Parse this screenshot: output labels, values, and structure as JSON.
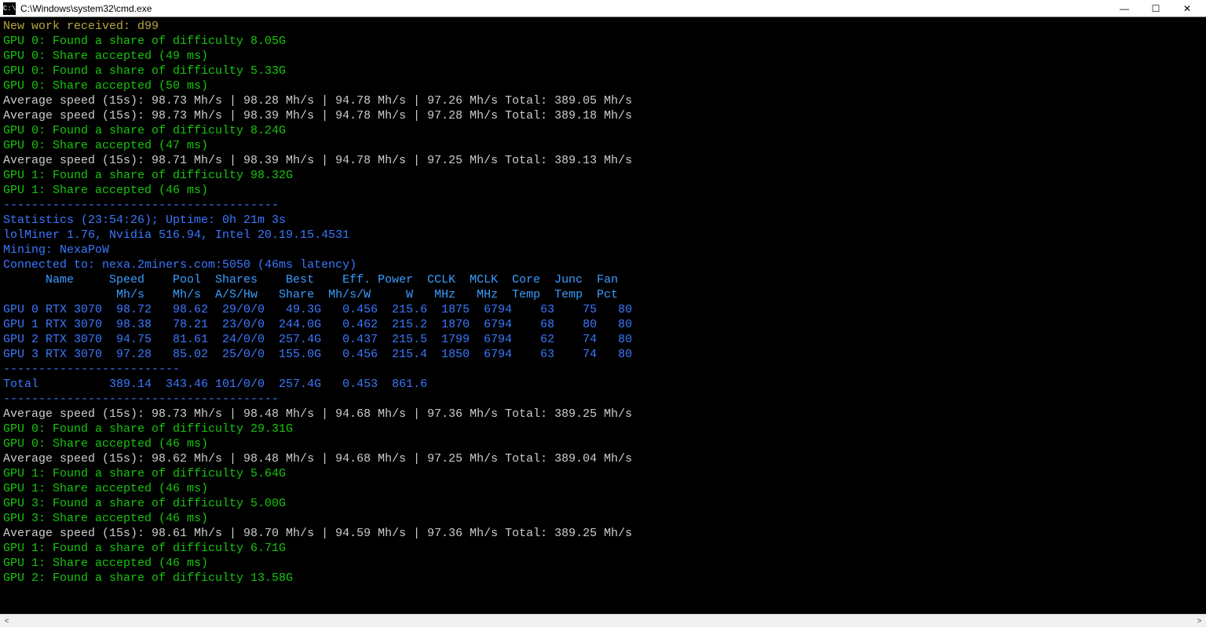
{
  "window": {
    "icon_label": "C:\\",
    "title": "C:\\Windows\\system32\\cmd.exe"
  },
  "lines": [
    {
      "cls": "c-olive",
      "text": "New work received: d99"
    },
    {
      "cls": "c-green",
      "text": "GPU 0: Found a share of difficulty 8.05G"
    },
    {
      "cls": "c-green",
      "text": "GPU 0: Share accepted (49 ms)"
    },
    {
      "cls": "c-green",
      "text": "GPU 0: Found a share of difficulty 5.33G"
    },
    {
      "cls": "c-green",
      "text": "GPU 0: Share accepted (50 ms)"
    },
    {
      "cls": "c-gray",
      "text": "Average speed (15s): 98.73 Mh/s | 98.28 Mh/s | 94.78 Mh/s | 97.26 Mh/s Total: 389.05 Mh/s"
    },
    {
      "cls": "c-gray",
      "text": "Average speed (15s): 98.73 Mh/s | 98.39 Mh/s | 94.78 Mh/s | 97.28 Mh/s Total: 389.18 Mh/s"
    },
    {
      "cls": "c-green",
      "text": "GPU 0: Found a share of difficulty 8.24G"
    },
    {
      "cls": "c-green",
      "text": "GPU 0: Share accepted (47 ms)"
    },
    {
      "cls": "c-gray",
      "text": "Average speed (15s): 98.71 Mh/s | 98.39 Mh/s | 94.78 Mh/s | 97.25 Mh/s Total: 389.13 Mh/s"
    },
    {
      "cls": "c-green",
      "text": "GPU 1: Found a share of difficulty 98.32G"
    },
    {
      "cls": "c-green",
      "text": "GPU 1: Share accepted (46 ms)"
    },
    {
      "cls": "c-blue",
      "text": "---------------------------------------"
    },
    {
      "cls": "c-blue",
      "text": "Statistics (23:54:26); Uptime: 0h 21m 3s"
    },
    {
      "cls": "c-blue",
      "text": "lolMiner 1.76, Nvidia 516.94, Intel 20.19.15.4531"
    },
    {
      "cls": "c-blue",
      "text": "Mining: NexaPoW"
    },
    {
      "cls": "c-blue",
      "text": "Connected to: nexa.2miners.com:5050 (46ms latency)"
    },
    {
      "cls": "c-blue",
      "text": ""
    },
    {
      "cls": "c-bblue",
      "text": "      Name     Speed    Pool  Shares    Best    Eff. Power  CCLK  MCLK  Core  Junc  Fan"
    },
    {
      "cls": "c-bblue",
      "text": "                Mh/s    Mh/s  A/S/Hw   Share  Mh/s/W     W   MHz   MHz  Temp  Temp  Pct"
    },
    {
      "cls": "c-blue",
      "text": "GPU 0 RTX 3070  98.72   98.62  29/0/0   49.3G   0.456  215.6  1875  6794    63    75   80"
    },
    {
      "cls": "c-blue",
      "text": "GPU 1 RTX 3070  98.38   78.21  23/0/0  244.0G   0.462  215.2  1870  6794    68    80   80"
    },
    {
      "cls": "c-blue",
      "text": "GPU 2 RTX 3070  94.75   81.61  24/0/0  257.4G   0.437  215.5  1799  6794    62    74   80"
    },
    {
      "cls": "c-blue",
      "text": "GPU 3 RTX 3070  97.28   85.02  25/0/0  155.0G   0.456  215.4  1850  6794    63    74   80"
    },
    {
      "cls": "c-blue",
      "text": "-------------------------"
    },
    {
      "cls": "c-blue",
      "text": "Total          389.14  343.46 101/0/0  257.4G   0.453  861.6"
    },
    {
      "cls": "c-blue",
      "text": "---------------------------------------"
    },
    {
      "cls": "c-gray",
      "text": "Average speed (15s): 98.73 Mh/s | 98.48 Mh/s | 94.68 Mh/s | 97.36 Mh/s Total: 389.25 Mh/s"
    },
    {
      "cls": "c-green",
      "text": "GPU 0: Found a share of difficulty 29.31G"
    },
    {
      "cls": "c-green",
      "text": "GPU 0: Share accepted (46 ms)"
    },
    {
      "cls": "c-gray",
      "text": "Average speed (15s): 98.62 Mh/s | 98.48 Mh/s | 94.68 Mh/s | 97.25 Mh/s Total: 389.04 Mh/s"
    },
    {
      "cls": "c-green",
      "text": "GPU 1: Found a share of difficulty 5.64G"
    },
    {
      "cls": "c-green",
      "text": "GPU 1: Share accepted (46 ms)"
    },
    {
      "cls": "c-green",
      "text": "GPU 3: Found a share of difficulty 5.00G"
    },
    {
      "cls": "c-green",
      "text": "GPU 3: Share accepted (46 ms)"
    },
    {
      "cls": "c-gray",
      "text": "Average speed (15s): 98.61 Mh/s | 98.70 Mh/s | 94.59 Mh/s | 97.36 Mh/s Total: 389.25 Mh/s"
    },
    {
      "cls": "c-green",
      "text": "GPU 1: Found a share of difficulty 6.71G"
    },
    {
      "cls": "c-green",
      "text": "GPU 1: Share accepted (46 ms)"
    },
    {
      "cls": "c-green",
      "text": "GPU 2: Found a share of difficulty 13.58G"
    }
  ],
  "stats_table": {
    "headers_row1": [
      "",
      "Name",
      "Speed",
      "Pool",
      "Shares",
      "Best",
      "Eff.",
      "Power",
      "CCLK",
      "MCLK",
      "Core",
      "Junc",
      "Fan"
    ],
    "headers_row2": [
      "",
      "",
      "Mh/s",
      "Mh/s",
      "A/S/Hw",
      "Share",
      "Mh/s/W",
      "W",
      "MHz",
      "MHz",
      "Temp",
      "Temp",
      "Pct"
    ],
    "rows": [
      {
        "gpu": "GPU 0",
        "name": "RTX 3070",
        "speed": "98.72",
        "pool": "98.62",
        "shares": "29/0/0",
        "best": "49.3G",
        "eff": "0.456",
        "power": "215.6",
        "cclk": "1875",
        "mclk": "6794",
        "core": "63",
        "junc": "75",
        "fan": "80"
      },
      {
        "gpu": "GPU 1",
        "name": "RTX 3070",
        "speed": "98.38",
        "pool": "78.21",
        "shares": "23/0/0",
        "best": "244.0G",
        "eff": "0.462",
        "power": "215.2",
        "cclk": "1870",
        "mclk": "6794",
        "core": "68",
        "junc": "80",
        "fan": "80"
      },
      {
        "gpu": "GPU 2",
        "name": "RTX 3070",
        "speed": "94.75",
        "pool": "81.61",
        "shares": "24/0/0",
        "best": "257.4G",
        "eff": "0.437",
        "power": "215.5",
        "cclk": "1799",
        "mclk": "6794",
        "core": "62",
        "junc": "74",
        "fan": "80"
      },
      {
        "gpu": "GPU 3",
        "name": "RTX 3070",
        "speed": "97.28",
        "pool": "85.02",
        "shares": "25/0/0",
        "best": "155.0G",
        "eff": "0.456",
        "power": "215.4",
        "cclk": "1850",
        "mclk": "6794",
        "core": "63",
        "junc": "74",
        "fan": "80"
      }
    ],
    "total": {
      "label": "Total",
      "speed": "389.14",
      "pool": "343.46",
      "shares": "101/0/0",
      "best": "257.4G",
      "eff": "0.453",
      "power": "861.6"
    }
  }
}
